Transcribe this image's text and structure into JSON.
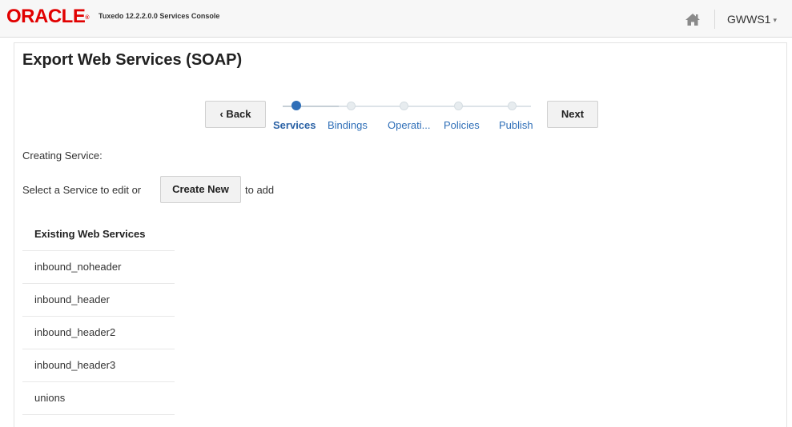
{
  "header": {
    "brand": "ORACLE",
    "product": "Tuxedo 12.2.2.0.0 Services Console",
    "home_icon": "home-icon",
    "user": "GWWS1",
    "user_caret": "▾"
  },
  "page": {
    "title": "Export Web Services (SOAP)"
  },
  "wizard": {
    "back_label": "‹ Back",
    "next_label": "Next",
    "steps": [
      {
        "label": "Services",
        "state": "active"
      },
      {
        "label": "Bindings",
        "state": "pending"
      },
      {
        "label": "Operati...",
        "state": "pending"
      },
      {
        "label": "Policies",
        "state": "pending"
      },
      {
        "label": "Publish",
        "state": "pending"
      }
    ]
  },
  "content": {
    "creating_label": "Creating Service:",
    "select_prefix": "Select a Service to edit or",
    "create_new_label": "Create New",
    "select_suffix": "to add"
  },
  "existing": {
    "header": "Existing Web Services",
    "items": [
      "inbound_noheader",
      "inbound_header",
      "inbound_header2",
      "inbound_header3",
      "unions"
    ]
  },
  "colors": {
    "brand_red": "#e10000",
    "link_blue": "#2f6fb8"
  }
}
